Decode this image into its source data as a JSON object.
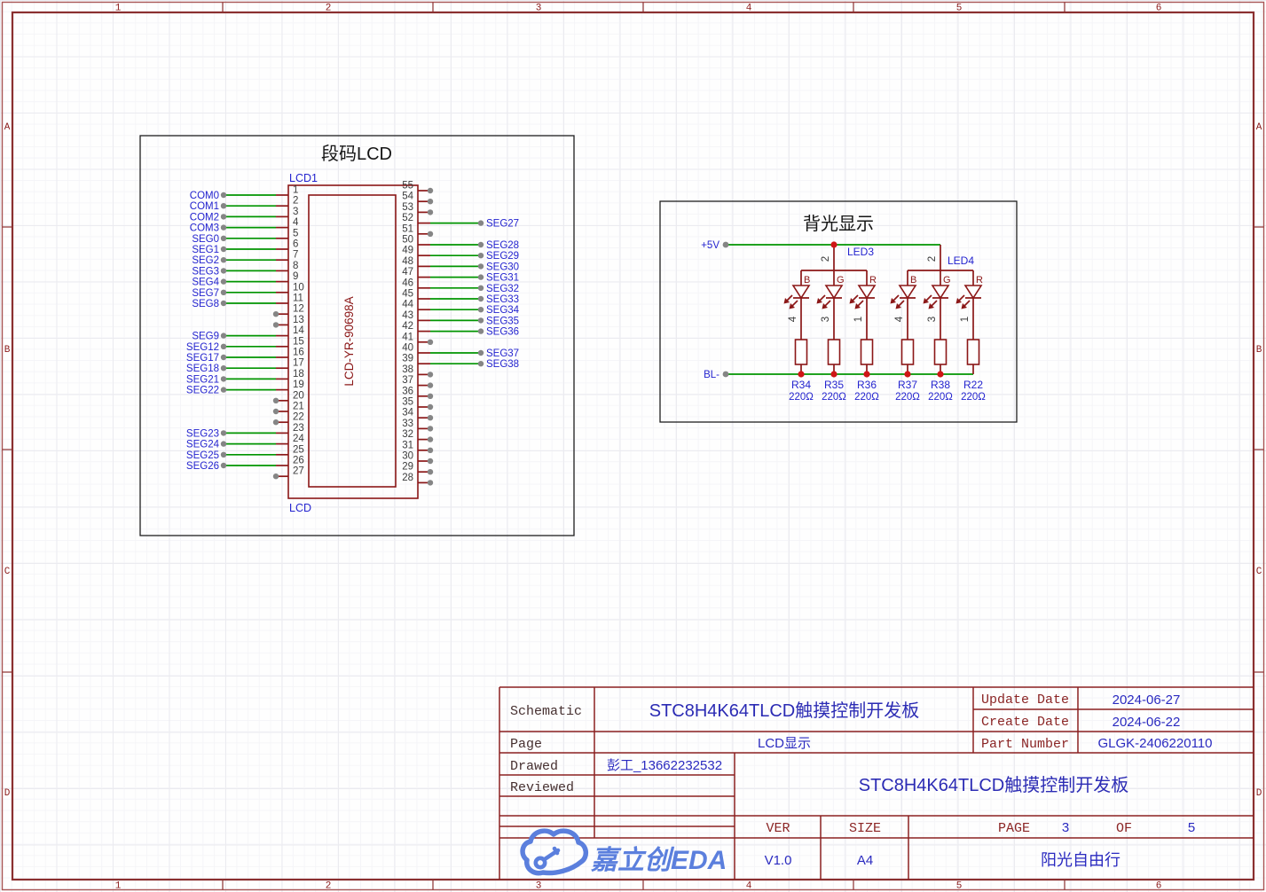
{
  "frame": {
    "columns": [
      "1",
      "2",
      "3",
      "4",
      "5",
      "6"
    ],
    "rows": [
      "A",
      "B",
      "C",
      "D"
    ]
  },
  "lcd_section": {
    "title": "段码LCD",
    "designator": "LCD1",
    "part": "LCD-YR-90698A",
    "footprint": "LCD",
    "left_pins": [
      {
        "num": "1",
        "net": "COM0"
      },
      {
        "num": "2",
        "net": "COM1"
      },
      {
        "num": "3",
        "net": "COM2"
      },
      {
        "num": "4",
        "net": "COM3"
      },
      {
        "num": "5",
        "net": "SEG0"
      },
      {
        "num": "6",
        "net": "SEG1"
      },
      {
        "num": "7",
        "net": "SEG2"
      },
      {
        "num": "8",
        "net": "SEG3"
      },
      {
        "num": "9",
        "net": "SEG4"
      },
      {
        "num": "10",
        "net": "SEG7"
      },
      {
        "num": "11",
        "net": "SEG8"
      },
      {
        "num": "12",
        "net": ""
      },
      {
        "num": "13",
        "net": ""
      },
      {
        "num": "14",
        "net": "SEG9"
      },
      {
        "num": "15",
        "net": "SEG12"
      },
      {
        "num": "16",
        "net": "SEG17"
      },
      {
        "num": "17",
        "net": "SEG18"
      },
      {
        "num": "18",
        "net": "SEG21"
      },
      {
        "num": "19",
        "net": "SEG22"
      },
      {
        "num": "20",
        "net": ""
      },
      {
        "num": "21",
        "net": ""
      },
      {
        "num": "22",
        "net": ""
      },
      {
        "num": "23",
        "net": "SEG23"
      },
      {
        "num": "24",
        "net": "SEG24"
      },
      {
        "num": "25",
        "net": "SEG25"
      },
      {
        "num": "26",
        "net": "SEG26"
      },
      {
        "num": "27",
        "net": ""
      }
    ],
    "right_pins": [
      {
        "num": "55",
        "net": ""
      },
      {
        "num": "54",
        "net": ""
      },
      {
        "num": "53",
        "net": ""
      },
      {
        "num": "52",
        "net": "SEG27"
      },
      {
        "num": "51",
        "net": ""
      },
      {
        "num": "50",
        "net": "SEG28"
      },
      {
        "num": "49",
        "net": "SEG29"
      },
      {
        "num": "48",
        "net": "SEG30"
      },
      {
        "num": "47",
        "net": "SEG31"
      },
      {
        "num": "46",
        "net": "SEG32"
      },
      {
        "num": "45",
        "net": "SEG33"
      },
      {
        "num": "44",
        "net": "SEG34"
      },
      {
        "num": "43",
        "net": "SEG35"
      },
      {
        "num": "42",
        "net": "SEG36"
      },
      {
        "num": "41",
        "net": ""
      },
      {
        "num": "40",
        "net": "SEG37"
      },
      {
        "num": "39",
        "net": "SEG38"
      },
      {
        "num": "38",
        "net": ""
      },
      {
        "num": "37",
        "net": ""
      },
      {
        "num": "36",
        "net": ""
      },
      {
        "num": "35",
        "net": ""
      },
      {
        "num": "34",
        "net": ""
      },
      {
        "num": "33",
        "net": ""
      },
      {
        "num": "32",
        "net": ""
      },
      {
        "num": "31",
        "net": ""
      },
      {
        "num": "30",
        "net": ""
      },
      {
        "num": "29",
        "net": ""
      },
      {
        "num": "28",
        "net": ""
      }
    ]
  },
  "backlight_section": {
    "title": "背光显示",
    "power_net": "+5V",
    "return_net": "BL-",
    "leds": [
      {
        "name": "LED3",
        "anode_pin": "2",
        "channels": [
          {
            "color": "B",
            "pin": "4",
            "res_ref": "R34",
            "res_val": "220Ω"
          },
          {
            "color": "G",
            "pin": "3",
            "res_ref": "R35",
            "res_val": "220Ω"
          },
          {
            "color": "R",
            "pin": "1",
            "res_ref": "R36",
            "res_val": "220Ω"
          }
        ]
      },
      {
        "name": "LED4",
        "anode_pin": "2",
        "channels": [
          {
            "color": "B",
            "pin": "4",
            "res_ref": "R37",
            "res_val": "220Ω"
          },
          {
            "color": "G",
            "pin": "3",
            "res_ref": "R38",
            "res_val": "220Ω"
          },
          {
            "color": "R",
            "pin": "1",
            "res_ref": "R22",
            "res_val": "220Ω"
          }
        ]
      }
    ]
  },
  "title_block": {
    "schematic_label": "Schematic",
    "schematic_value": "STC8H4K64TLCD触摸控制开发板",
    "update_date_label": "Update Date",
    "update_date": "2024-06-27",
    "create_date_label": "Create Date",
    "create_date": "2024-06-22",
    "page_label": "Page",
    "page_value": "LCD显示",
    "part_number_label": "Part Number",
    "part_number": "GLGK-2406220110",
    "drawed_label": "Drawed",
    "drawed_value": "彭工_13662232532",
    "reviewed_label": "Reviewed",
    "reviewed_value": "",
    "board_title": "STC8H4K64TLCD触摸控制开发板",
    "ver_label": "VER",
    "ver_value": "V1.0",
    "size_label": "SIZE",
    "size_value": "A4",
    "page_word": "PAGE",
    "page_num": "3",
    "of_word": "OF",
    "page_total": "5",
    "company": "阳光自由行",
    "logo_text": "嘉立创EDA"
  },
  "colors": {
    "wire_green": "#009400",
    "symbol_maroon": "#8b1717",
    "junction_red": "#cf1616",
    "net_blue": "#2424cf",
    "frame_maroon": "#8b3030",
    "logo_blue": "#5b7fdd"
  }
}
